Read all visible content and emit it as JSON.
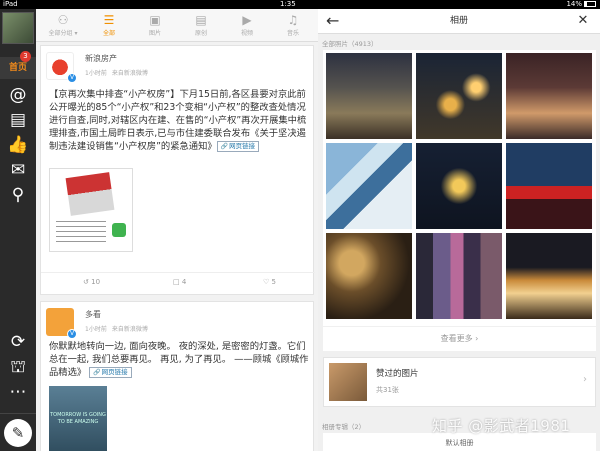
{
  "status_bar": {
    "device": "iPad",
    "time": "1:35",
    "battery": "14%"
  },
  "sidebar": {
    "home_label": "首页",
    "home_badge": "3",
    "icons": [
      "at-icon",
      "comment-icon",
      "like-icon",
      "mail-icon",
      "search-icon",
      "refresh-icon",
      "theme-icon",
      "more-icon",
      "compose-icon"
    ]
  },
  "feed": {
    "tabs": [
      {
        "label": "全部分组 ▾"
      },
      {
        "label": "全部"
      },
      {
        "label": "图片"
      },
      {
        "label": "原创"
      },
      {
        "label": "视频"
      },
      {
        "label": "音乐"
      }
    ],
    "posts": [
      {
        "name": "新浪房产",
        "time": "1小时前",
        "source": "来自新浪微博",
        "text": "【京再次集中排查“小产权房”】下月15日前,各区县要对京此前公开曝光的85个“小产权”和23个变相“小产权”的整改查处情况进行自查,同时,对辖区内在建、在售的“小产权”再次开展集中梳理排查,市国土局昨日表示,已与市住建委联合发布《关于坚决遏制违法建设销售“小产权房”的紧急通知》",
        "link_label": "网页链接",
        "reposts": "10",
        "comments": "4",
        "likes": "5"
      },
      {
        "name": "多看",
        "time": "1小时前",
        "source": "来自新浪微博",
        "text": "你默默地转向一边, 面向夜晚。 夜的深处, 是密密的灯盏。它们总在一起, 我们总要再见。 再见, 为了再见。 ——顾城《顾城作品精选》",
        "link_label": "网页链接",
        "image_text": "TOMORROW IS GOING TO BE AMAZING"
      }
    ]
  },
  "album": {
    "title": "相册",
    "all_photos_label": "全部照片（4913）",
    "more_label": "查看更多 ›",
    "liked": {
      "title": "赞过的图片",
      "count": "共31张"
    },
    "section2_label": "相册专辑（2）",
    "bottom_text": "默认相册"
  },
  "watermark": "知乎 @影武者1981"
}
